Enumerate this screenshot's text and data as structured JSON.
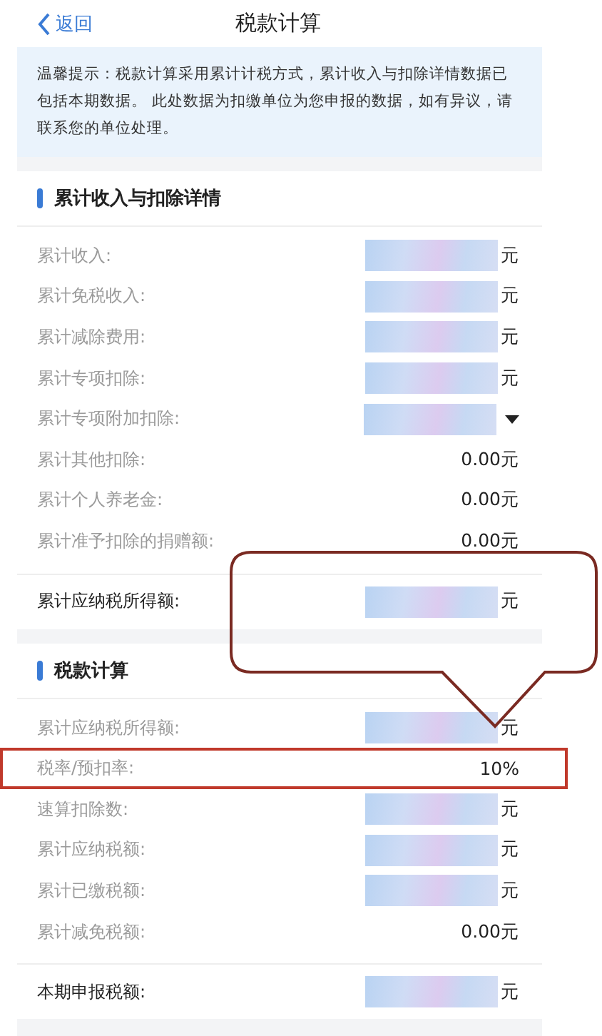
{
  "nav": {
    "back": "返回",
    "title": "税款计算"
  },
  "notice": "温馨提示：税款计算采用累计计税方式，累计收入与扣除详情数据已包括本期数据。 此处数据为扣缴单位为您申报的数据，如有异议，请联系您的单位处理。",
  "sections": [
    {
      "title": "累计收入与扣除详情",
      "rows": [
        {
          "kind": "masked",
          "label": "累计收入:",
          "unit": "元",
          "highlighted": false
        },
        {
          "kind": "masked",
          "label": "累计免税收入:",
          "unit": "元",
          "highlighted": false
        },
        {
          "kind": "masked",
          "label": "累计减除费用:",
          "unit": "元",
          "highlighted": false
        },
        {
          "kind": "masked",
          "label": "累计专项扣除:",
          "unit": "元",
          "highlighted": false
        },
        {
          "kind": "select",
          "label": "累计专项附加扣除:",
          "highlighted": false
        },
        {
          "kind": "text",
          "label": "累计其他扣除:",
          "value": "0.00元",
          "highlighted": false
        },
        {
          "kind": "text",
          "label": "累计个人养老金:",
          "value": "0.00元",
          "highlighted": false
        },
        {
          "kind": "text",
          "label": "累计准予扣除的捐赠额:",
          "value": "0.00元",
          "highlighted": false
        }
      ],
      "total": {
        "kind": "masked",
        "label": "累计应纳税所得额:",
        "unit": "元"
      }
    },
    {
      "title": "税款计算",
      "rows": [
        {
          "kind": "masked",
          "label": "累计应纳税所得额:",
          "unit": "元",
          "highlighted": false
        },
        {
          "kind": "text",
          "label": "税率/预扣率:",
          "value": "10%",
          "highlighted": true
        },
        {
          "kind": "masked",
          "label": "速算扣除数:",
          "unit": "元",
          "highlighted": false
        },
        {
          "kind": "masked",
          "label": "累计应纳税额:",
          "unit": "元",
          "highlighted": false
        },
        {
          "kind": "masked",
          "label": "累计已缴税额:",
          "unit": "元",
          "highlighted": false
        },
        {
          "kind": "text",
          "label": "累计减免税额:",
          "value": "0.00元",
          "highlighted": false
        }
      ],
      "total": {
        "kind": "masked",
        "label": "本期申报税额:",
        "unit": "元"
      }
    }
  ]
}
